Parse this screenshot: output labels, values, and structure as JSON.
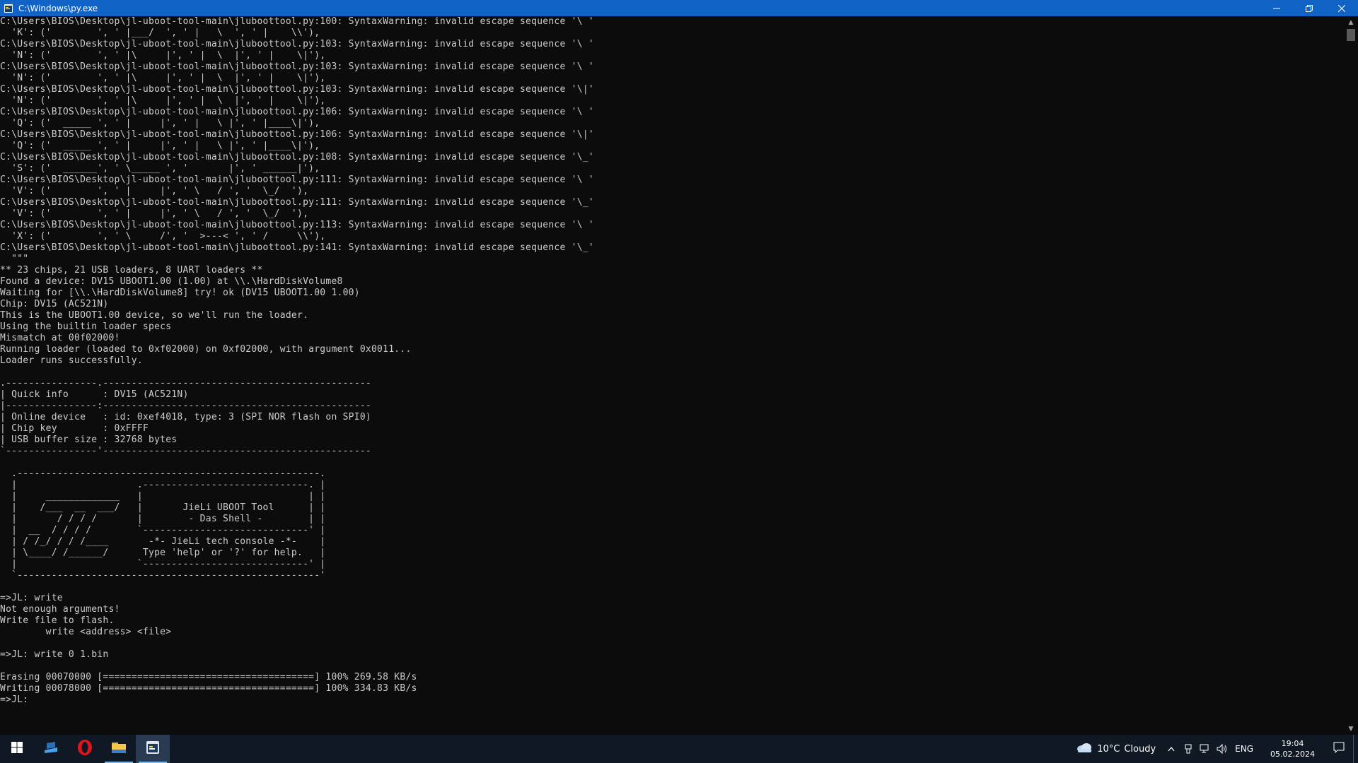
{
  "window": {
    "title": "C:\\Windows\\py.exe",
    "controls": {
      "minimize": "minimize-icon",
      "restore": "restore-icon",
      "close": "close-icon"
    }
  },
  "console": {
    "text": "C:\\Users\\BIOS\\Desktop\\jl-uboot-tool-main\\jluboottool.py:100: SyntaxWarning: invalid escape sequence '\\ '\n  'K': ('        ', ' |___/  ', ' |   \\  ', ' |    \\\\'),\nC:\\Users\\BIOS\\Desktop\\jl-uboot-tool-main\\jluboottool.py:103: SyntaxWarning: invalid escape sequence '\\ '\n  'N': ('        ', ' |\\     |', ' |  \\  |', ' |    \\|'),\nC:\\Users\\BIOS\\Desktop\\jl-uboot-tool-main\\jluboottool.py:103: SyntaxWarning: invalid escape sequence '\\ '\n  'N': ('        ', ' |\\     |', ' |  \\  |', ' |    \\|'),\nC:\\Users\\BIOS\\Desktop\\jl-uboot-tool-main\\jluboottool.py:103: SyntaxWarning: invalid escape sequence '\\|'\n  'N': ('        ', ' |\\     |', ' |  \\  |', ' |    \\|'),\nC:\\Users\\BIOS\\Desktop\\jl-uboot-tool-main\\jluboottool.py:106: SyntaxWarning: invalid escape sequence '\\ '\n  'Q': ('  _____ ', ' |     |', ' |   \\ |', ' |____\\|'),\nC:\\Users\\BIOS\\Desktop\\jl-uboot-tool-main\\jluboottool.py:106: SyntaxWarning: invalid escape sequence '\\|'\n  'Q': ('  _____ ', ' |     |', ' |   \\ |', ' |____\\|'),\nC:\\Users\\BIOS\\Desktop\\jl-uboot-tool-main\\jluboottool.py:108: SyntaxWarning: invalid escape sequence '\\_'\n  'S': ('  ______', ' \\_____ ', '       |', ' ______|'),\nC:\\Users\\BIOS\\Desktop\\jl-uboot-tool-main\\jluboottool.py:111: SyntaxWarning: invalid escape sequence '\\ '\n  'V': ('        ', ' |     |', ' \\   / ', '  \\_/  '),\nC:\\Users\\BIOS\\Desktop\\jl-uboot-tool-main\\jluboottool.py:111: SyntaxWarning: invalid escape sequence '\\_'\n  'V': ('        ', ' |     |', ' \\   / ', '  \\_/  '),\nC:\\Users\\BIOS\\Desktop\\jl-uboot-tool-main\\jluboottool.py:113: SyntaxWarning: invalid escape sequence '\\ '\n  'X': ('        ', ' \\     /', '  >---< ', ' /     \\\\'),\nC:\\Users\\BIOS\\Desktop\\jl-uboot-tool-main\\jluboottool.py:141: SyntaxWarning: invalid escape sequence '\\_'\n  \"\"\"\n** 23 chips, 21 USB loaders, 8 UART loaders **\nFound a device: DV15 UBOOT1.00 (1.00) at \\\\.\\HardDiskVolume8\nWaiting for [\\\\.\\HardDiskVolume8] try! ok (DV15 UBOOT1.00 1.00)\nChip: DV15 (AC521N)\nThis is the UBOOT1.00 device, so we'll run the loader.\nUsing the builtin loader specs\nMismatch at 00f02000!\nRunning loader (loaded to 0xf02000) on 0xf02000, with argument 0x0011...\nLoader runs successfully.\n\n.----------------.-----------------------------------------------\n| Quick info      : DV15 (AC521N)\n|----------------:-----------------------------------------------\n| Online device   : id: 0xef4018, type: 3 (SPI NOR flash on SPI0)\n| Chip key        : 0xFFFF\n| USB buffer size : 32768 bytes\n`----------------'-----------------------------------------------\n\n  .-----------------------------------------------------.\n  |                     .-----------------------------. |\n  |     _____________   |                             | |\n  |    /___  __  ___/   |       JieLi UBOOT Tool      | |\n  |       / / / /       |        - Das Shell -        | |\n  |  __  / / / /        `-----------------------------' |\n  | / /_/ / / /____       -*- JieLi tech console -*-    |\n  | \\____/ /______/      Type 'help' or '?' for help.   |\n  |                     `-----------------------------' |\n  `-----------------------------------------------------'\n\n=>JL: write\nNot enough arguments!\nWrite file to flash.\n        write <address> <file>\n\n=>JL: write 0 1.bin\n\nErasing 00070000 [=====================================] 100% 269.58 KB/s\nWriting 00078000 [=====================================] 100% 334.83 KB/s\n=>JL: "
  },
  "taskbar": {
    "pinned": [
      {
        "name": "start-button",
        "icon": "windows-logo-icon"
      },
      {
        "name": "taskbar-app-1",
        "icon": "blue-app-icon"
      },
      {
        "name": "taskbar-opera",
        "icon": "opera-icon"
      },
      {
        "name": "taskbar-file-explorer",
        "icon": "folder-icon"
      },
      {
        "name": "taskbar-python-console",
        "icon": "python-icon"
      }
    ],
    "weather": {
      "temperature": "10°C",
      "condition": "Cloudy"
    },
    "language": "ENG",
    "time": "19:04",
    "date": "05.02.2024"
  },
  "colors": {
    "titlebar": "#1163c6",
    "console_bg": "#0c0c0c",
    "console_fg": "#cccccc",
    "taskbar_bg": "#101824"
  }
}
